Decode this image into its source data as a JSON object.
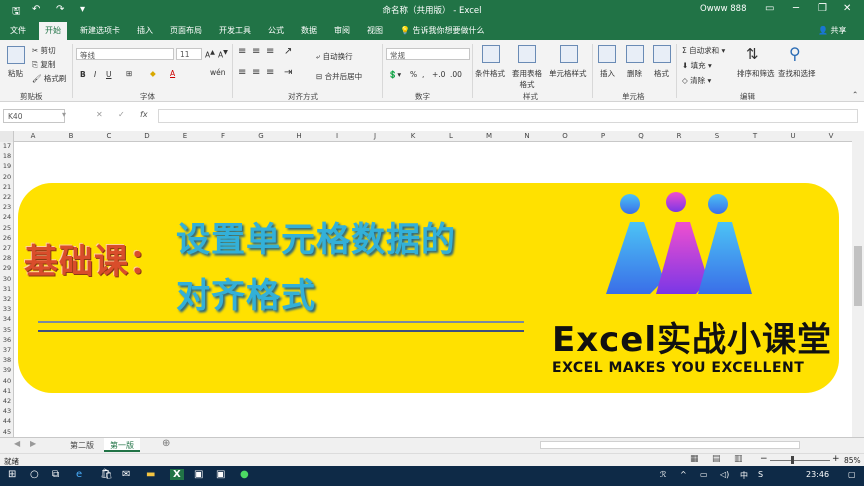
{
  "titlebar": {
    "doc_title": "命名称（共用版） - Excel",
    "user": "Owww 888",
    "save_icon": "save-icon",
    "undo_icon": "undo-icon",
    "redo_icon": "redo-icon"
  },
  "tabs": [
    "文件",
    "开始",
    "新建选项卡",
    "插入",
    "页面布局",
    "开发工具",
    "公式",
    "数据",
    "审阅",
    "视图"
  ],
  "active_tab": "开始",
  "tellme": "告诉我你想要做什么",
  "share": "共享",
  "ribbon": {
    "clipboard": {
      "paste": "粘贴",
      "cut": "剪切",
      "copy": "复制",
      "format_painter": "格式刷",
      "label": "剪贴板"
    },
    "font": {
      "name": "等线",
      "size": "11",
      "label": "字体"
    },
    "alignment": {
      "wrap": "自动换行",
      "merge": "合并后居中",
      "label": "对齐方式"
    },
    "number": {
      "format": "常规",
      "label": "数字"
    },
    "styles": {
      "conditional": "条件格式",
      "table": "套用表格格式",
      "cell": "单元格样式",
      "label": "样式"
    },
    "cells": {
      "insert": "插入",
      "delete": "删除",
      "format": "格式",
      "label": "单元格"
    },
    "editing": {
      "autosum": "自动求和",
      "fill": "填充",
      "clear": "清除",
      "sort": "排序和筛选",
      "find": "查找和选择",
      "label": "编辑"
    }
  },
  "formula_bar": {
    "name_box": "K40",
    "fx": "fx"
  },
  "columns": [
    "A",
    "B",
    "C",
    "D",
    "E",
    "F",
    "G",
    "H",
    "I",
    "J",
    "K",
    "L",
    "M",
    "N",
    "O",
    "P",
    "Q",
    "R",
    "S",
    "T",
    "U",
    "V"
  ],
  "rows": [
    "17",
    "18",
    "19",
    "20",
    "21",
    "22",
    "23",
    "24",
    "25",
    "26",
    "27",
    "28",
    "29",
    "30",
    "31",
    "32",
    "33",
    "34",
    "35",
    "36",
    "37",
    "38",
    "39",
    "40",
    "41",
    "42",
    "43",
    "44",
    "45"
  ],
  "banner": {
    "prefix": "基础课：",
    "title_line1": "设置单元格数据的",
    "title_line2": "对齐格式",
    "brand": "Excel实战小课堂",
    "tagline": "EXCEL MAKES YOU EXCELLENT",
    "colors": {
      "background": "#ffe100",
      "prefix": "#d94d2b",
      "title": "#33b0d8"
    }
  },
  "sheets": [
    "第二版",
    "第一版"
  ],
  "active_sheet": "第一版",
  "status": {
    "mode": "就绪",
    "zoom": "85%"
  },
  "taskbar": {
    "time": "23:46",
    "ime": "中",
    "lang": "S"
  }
}
